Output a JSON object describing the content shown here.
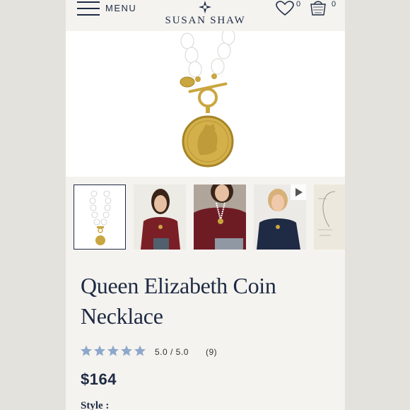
{
  "header": {
    "menu_label": "MENU",
    "brand": "SUSAN SHAW",
    "wishlist_count": "0",
    "cart_count": "0"
  },
  "gallery": {
    "thumbnails": [
      {
        "icon": "necklace-thumbnail",
        "selected": true
      },
      {
        "icon": "model-thumbnail"
      },
      {
        "icon": "model-thumbnail"
      },
      {
        "icon": "video-thumbnail"
      },
      {
        "icon": "size-diagram-thumbnail"
      }
    ]
  },
  "product": {
    "title": "Queen Elizabeth Coin Necklace",
    "rating": "5.0 / 5.0",
    "review_count": "(9)",
    "stars": 5,
    "price": "$164",
    "style_label": "Style :"
  },
  "colors": {
    "navy": "#1f2a44",
    "star_blue": "#8ea7cb",
    "gold": "#c9a640",
    "background": "#f4f3ef"
  }
}
